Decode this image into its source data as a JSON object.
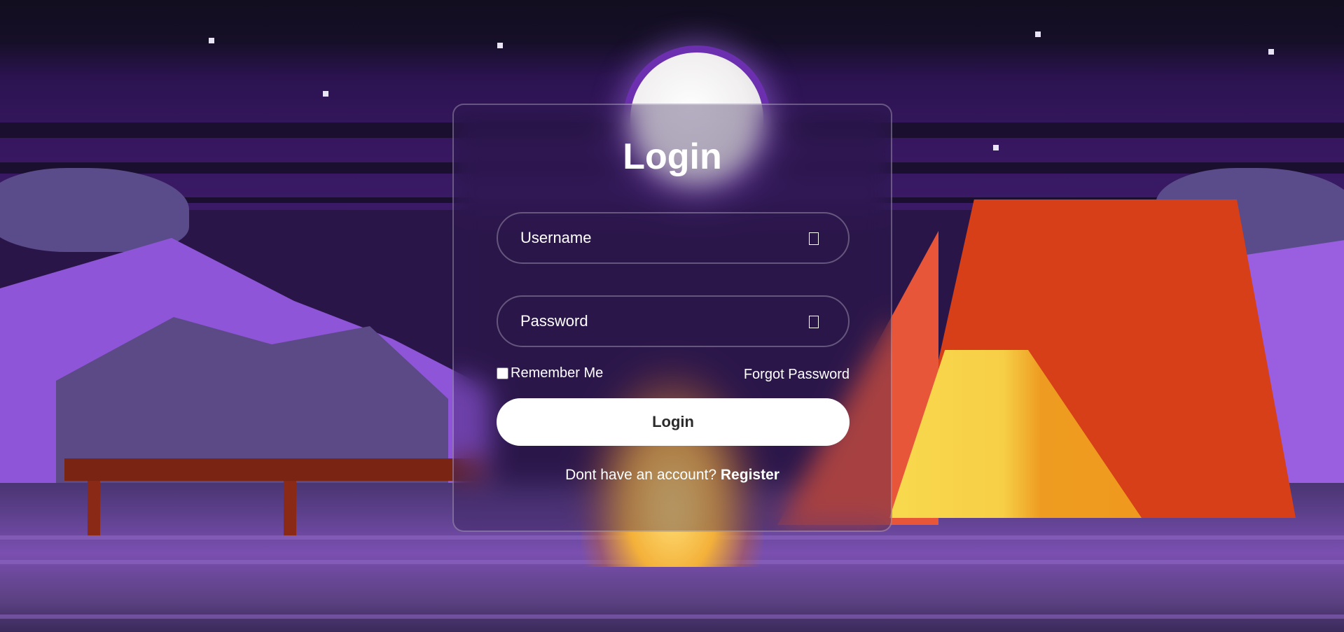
{
  "login_form": {
    "title": "Login",
    "username_placeholder": "Username",
    "username_icon": "user-icon",
    "password_placeholder": "Password",
    "password_icon": "lock-icon",
    "remember_label": "Remember Me",
    "remember_checked": false,
    "forgot_label": "Forgot Password",
    "submit_label": "Login",
    "register_prompt": "Dont have an account?",
    "register_label": "Register"
  },
  "colors": {
    "card_border": "#ffffff",
    "button_bg": "#ffffff",
    "button_text": "#2b2b2b",
    "text": "#ffffff"
  }
}
